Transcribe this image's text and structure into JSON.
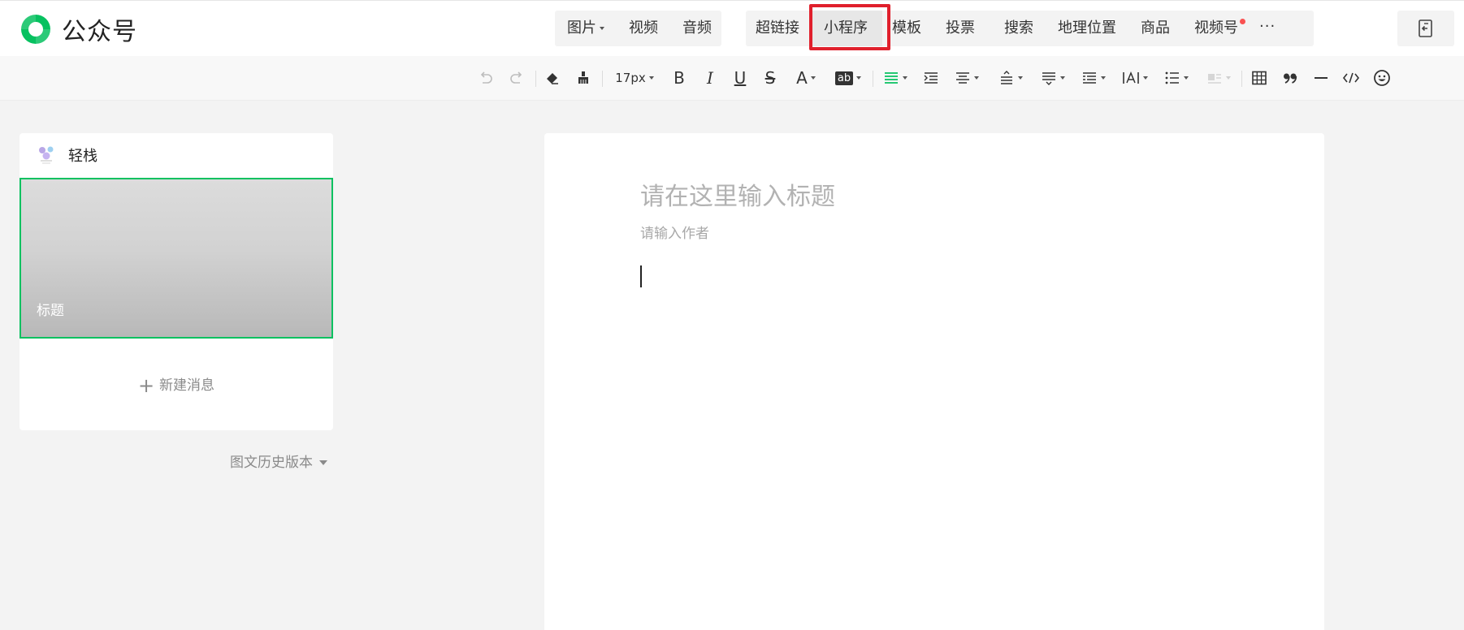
{
  "brand": {
    "name": "公众号",
    "logo_icon": "wechat-official-accounts-logo-icon",
    "accent": "#07c160"
  },
  "media_group": [
    {
      "label": "图片",
      "has_dropdown": true
    },
    {
      "label": "视频",
      "has_dropdown": false
    },
    {
      "label": "音频",
      "has_dropdown": false
    }
  ],
  "insert_group": [
    {
      "label": "超链接"
    },
    {
      "label": "小程序",
      "active": true,
      "highlighted": true
    },
    {
      "label": "模板"
    },
    {
      "label": "投票"
    },
    {
      "label": "搜索"
    },
    {
      "label": "地理位置"
    },
    {
      "label": "商品"
    },
    {
      "label": "视频号",
      "badge": "red-dot"
    }
  ],
  "more_icon": "more-dots-icon",
  "right_button_icon": "exit-edit-icon",
  "format_toolbar": {
    "font_size": "17px",
    "bold": "B",
    "italic": "I",
    "underline": "U",
    "strike": "S",
    "font_color": "A",
    "bg_color": "ab",
    "icons": [
      "undo-icon",
      "redo-icon",
      "clear-format-icon",
      "format-painter-icon",
      "align-justify-icon",
      "indent-icon",
      "align-center-icon",
      "line-height-icon",
      "paragraph-spacing-icon",
      "first-line-indent-icon",
      "letter-spacing-icon",
      "list-icon",
      "float-icon",
      "table-icon",
      "quote-icon",
      "divider-icon",
      "code-icon",
      "emoji-icon"
    ],
    "active_color": "#07c160"
  },
  "left_panel": {
    "account_name": "轻栈",
    "cover_title": "标题",
    "new_message": "新建消息",
    "history": "图文历史版本"
  },
  "editor": {
    "title_placeholder": "请在这里输入标题",
    "author_placeholder": "请输入作者"
  },
  "colors": {
    "highlight_border": "#e0202c",
    "selected_border": "#07c160",
    "badge": "#fa5151"
  }
}
